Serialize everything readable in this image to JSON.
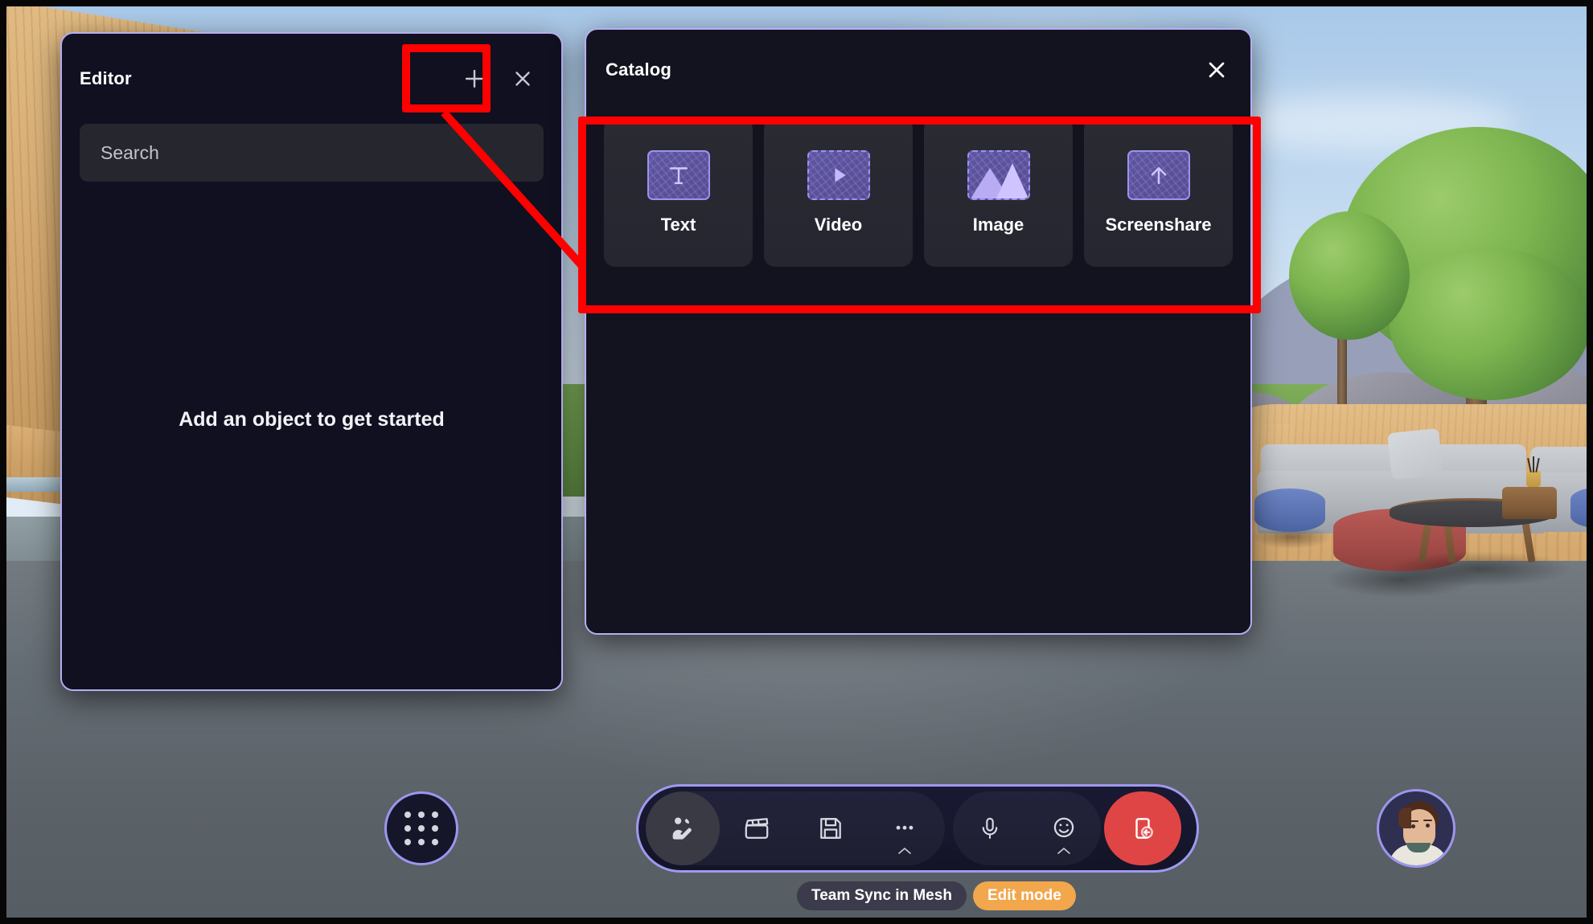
{
  "app": {
    "environment_name": "Microsoft Mesh immersive space",
    "room_label": "Team Sync in Mesh",
    "mode_badge": "Edit mode"
  },
  "editor_panel": {
    "title": "Editor",
    "add_button_label": "+",
    "add_button_icon": "plus-icon",
    "close_button_icon": "close-icon",
    "search": {
      "placeholder": "Search",
      "value": ""
    },
    "empty_state_message": "Add an object to get started"
  },
  "catalog_panel": {
    "title": "Catalog",
    "close_button_icon": "close-icon",
    "items": [
      {
        "label": "Text",
        "icon": "text-t-icon",
        "border": "solid"
      },
      {
        "label": "Video",
        "icon": "video-play-icon",
        "border": "dashed"
      },
      {
        "label": "Image",
        "icon": "image-photo-icon",
        "border": "dashed"
      },
      {
        "label": "Screenshare",
        "icon": "arrow-up-icon",
        "border": "solid"
      }
    ]
  },
  "annotations": [
    {
      "name": "highlight-add-button",
      "color": "#ff0000",
      "shape": "rectangle"
    },
    {
      "name": "highlight-catalog-items",
      "color": "#ff0000",
      "shape": "rectangle"
    },
    {
      "name": "leader-line",
      "color": "#ff0000",
      "shape": "line"
    }
  ],
  "apps_button": {
    "icon": "grid-dots-icon",
    "label": "Apps"
  },
  "toolbar": {
    "buttons": [
      {
        "name": "avatar-editor-button",
        "icon": "people-avatar-icon",
        "active": true,
        "chevron": false
      },
      {
        "name": "clapperboard-button",
        "icon": "clapperboard-icon",
        "active": false,
        "chevron": false
      },
      {
        "name": "save-button",
        "icon": "floppy-save-icon",
        "active": false,
        "chevron": false
      },
      {
        "name": "more-button",
        "icon": "more-dots-icon",
        "active": false,
        "chevron": true
      },
      {
        "name": "microphone-button",
        "icon": "microphone-icon",
        "active": false,
        "chevron": false
      },
      {
        "name": "reactions-button",
        "icon": "emoji-smile-icon",
        "active": false,
        "chevron": true
      },
      {
        "name": "leave-button",
        "icon": "leave-door-icon",
        "active": false,
        "chevron": false
      }
    ]
  },
  "user_avatar": {
    "icon": "avatar-portrait",
    "label": "User avatar"
  },
  "colors": {
    "panel_border": "#b5aef2",
    "panel_background": "#12121f",
    "annotation_red": "#ff0000",
    "edit_mode_orange": "#f2a74c",
    "leave_red": "#e04545",
    "thumb_purple": "#9b93f0"
  }
}
